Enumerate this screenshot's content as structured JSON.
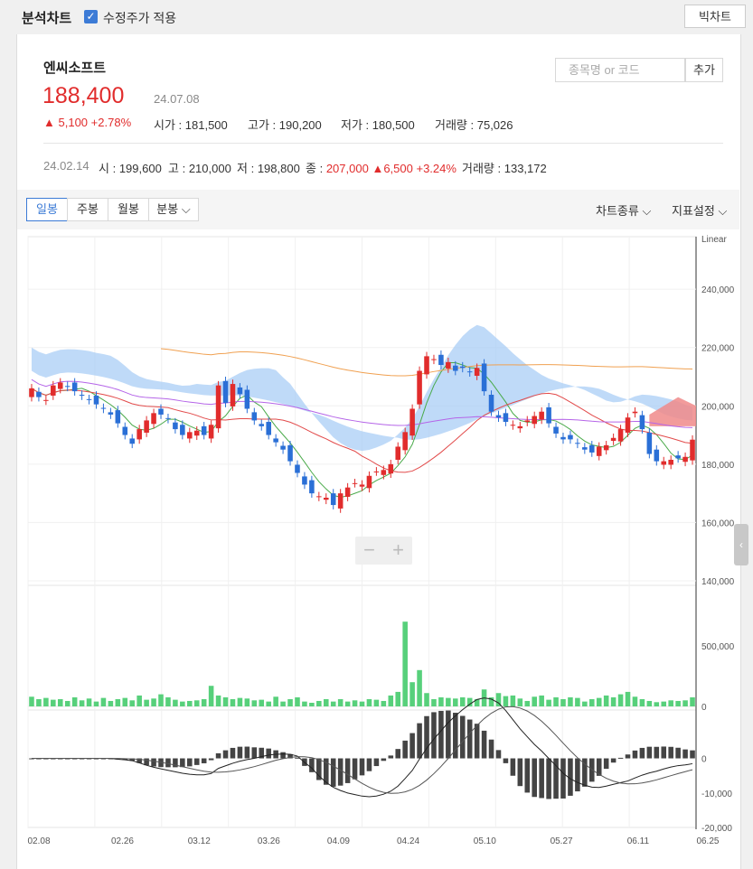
{
  "topbar": {
    "title": "분석차트",
    "adjusted_label": "수정주가 적용",
    "adjusted_checked": true,
    "big_chart_label": "빅차트"
  },
  "stock": {
    "name": "엔씨소프트",
    "price": "188,400",
    "date": "24.07.08",
    "change": "5,100",
    "change_pct": "+2.78%",
    "open_label": "시가",
    "open": "181,500",
    "high_label": "고가",
    "high": "190,200",
    "low_label": "저가",
    "low": "180,500",
    "vol_label": "거래량",
    "volume": "75,026"
  },
  "search": {
    "placeholder": "종목명 or 코드",
    "add_label": "추가"
  },
  "previous": {
    "date": "24.02.14",
    "open_label": "시",
    "open": "199,600",
    "high_label": "고",
    "high": "210,000",
    "low_label": "저",
    "low": "198,800",
    "close_label": "종",
    "close": "207,000",
    "change": "6,500",
    "change_pct": "+3.24%",
    "vol_label": "거래량",
    "volume": "133,172"
  },
  "tabs": [
    {
      "label": "일봉",
      "active": true
    },
    {
      "label": "주봉",
      "active": false
    },
    {
      "label": "월봉",
      "active": false
    },
    {
      "label": "분봉",
      "active": false
    }
  ],
  "menus": {
    "chart_type": "차트종류",
    "indicators": "지표설정"
  },
  "colors": {
    "up": "#e12c2c",
    "down": "#2a6fd6",
    "volume": "#57d07b",
    "cloud_blue": "#a9cdf5",
    "cloud_red": "#f08a8a",
    "ma_orange": "#f0a050",
    "ma_purple": "#b565e8",
    "ma_red": "#e24a4a",
    "ma_green": "#4aaa4a"
  },
  "chart_data": {
    "type": "candlestick",
    "scale_label": "Linear",
    "price_axis": {
      "ticks": [
        "240,000",
        "220,000",
        "200,000",
        "180,000",
        "160,000",
        "140,000"
      ],
      "ylim": [
        140000,
        258000
      ]
    },
    "volume_axis": {
      "ticks": [
        "500,000",
        "0"
      ],
      "ylim": [
        0,
        1000000
      ]
    },
    "macd_axis": {
      "ticks": [
        "0",
        "-10,000",
        "-20,000"
      ],
      "ylim": [
        -20000,
        14000
      ]
    },
    "x_tick_labels": [
      "02.08",
      "02.26",
      "03.12",
      "03.26",
      "04.09",
      "04.24",
      "05.10",
      "05.27",
      "06.11",
      "06.25"
    ],
    "closes": [
      206000,
      203000,
      202000,
      207000,
      208000,
      206500,
      205000,
      203500,
      202000,
      200500,
      199000,
      197000,
      194000,
      190000,
      187000,
      192000,
      195000,
      197500,
      197000,
      195500,
      192000,
      190000,
      191000,
      191500,
      190000,
      193500,
      207000,
      201000,
      207500,
      204000,
      199000,
      195000,
      193000,
      190000,
      187500,
      185000,
      181000,
      177000,
      173000,
      170000,
      169000,
      168500,
      166000,
      170000,
      172000,
      173500,
      173000,
      176000,
      177500,
      178000,
      180000,
      186000,
      191000,
      199000,
      212000,
      217000,
      216000,
      214000,
      215000,
      212000,
      213000,
      211500,
      213000,
      205000,
      198000,
      196000,
      194500,
      193500,
      193000,
      195000,
      196500,
      198000,
      194000,
      190500,
      188500,
      188500,
      187000,
      185000,
      184000,
      186000,
      186500,
      189000,
      192000,
      196000,
      198000,
      192000,
      183500,
      181000,
      181000,
      181500,
      182000,
      182500,
      188400
    ],
    "volume": [
      80000,
      60000,
      70000,
      55000,
      60000,
      45000,
      75000,
      50000,
      65000,
      40000,
      70000,
      45000,
      60000,
      70000,
      50000,
      90000,
      55000,
      65000,
      100000,
      75000,
      55000,
      40000,
      45000,
      50000,
      60000,
      170000,
      90000,
      75000,
      60000,
      70000,
      65000,
      50000,
      55000,
      40000,
      80000,
      40000,
      60000,
      75000,
      40000,
      30000,
      45000,
      60000,
      40000,
      60000,
      40000,
      50000,
      40000,
      60000,
      55000,
      45000,
      90000,
      120000,
      700000,
      200000,
      300000,
      110000,
      60000,
      75000,
      70000,
      65000,
      75000,
      70000,
      60000,
      140000,
      75000,
      110000,
      85000,
      90000,
      65000,
      45000,
      80000,
      90000,
      55000,
      75000,
      60000,
      75000,
      70000,
      40000,
      60000,
      70000,
      90000,
      75000,
      100000,
      120000,
      80000,
      60000,
      45000,
      35000,
      40000,
      50000,
      45000,
      50000,
      75000
    ],
    "signal_zero_line": 0
  }
}
